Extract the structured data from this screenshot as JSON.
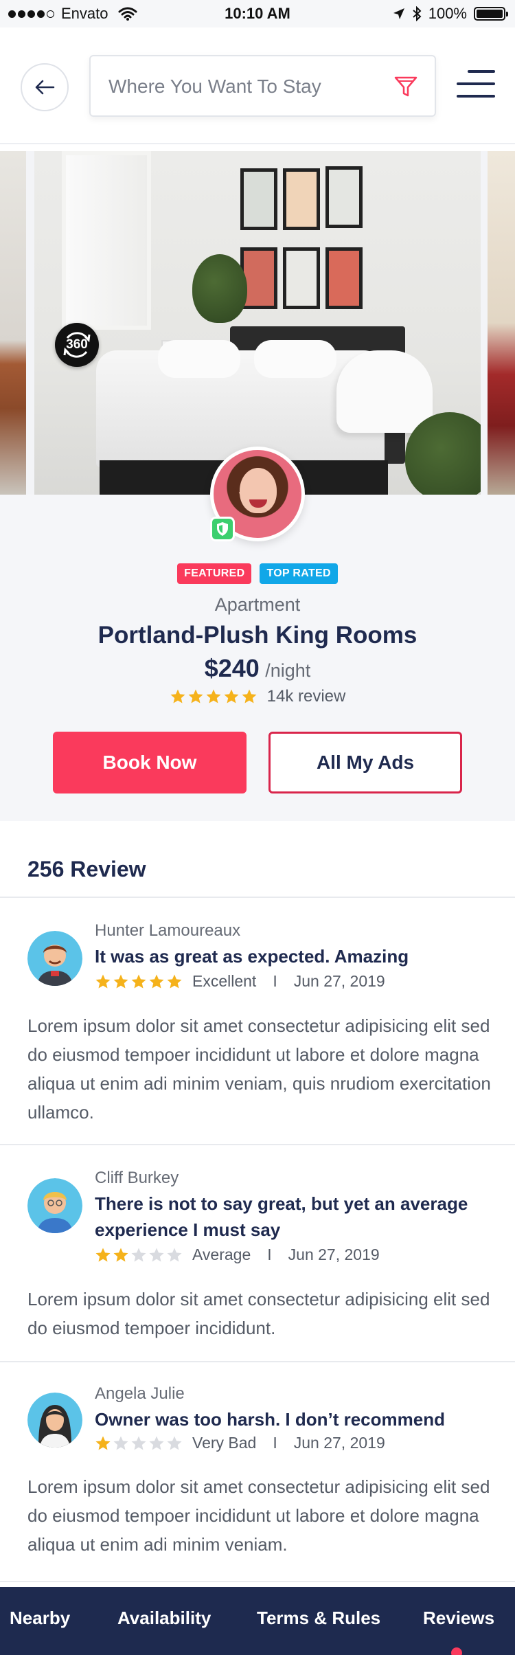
{
  "status_bar": {
    "carrier": "Envato",
    "time": "10:10 AM",
    "battery": "100%"
  },
  "search": {
    "placeholder": "Where You Want To Stay"
  },
  "gallery": {
    "badge_360": "360"
  },
  "listing": {
    "tags": [
      "FEATURED",
      "TOP RATED"
    ],
    "type": "Apartment",
    "title": "Portland-Plush King Rooms",
    "price": "$240",
    "price_unit": "/night",
    "rating": 5,
    "review_count": "14k review",
    "book_label": "Book Now",
    "ads_label": "All My Ads"
  },
  "reviews": {
    "heading": "256 Review",
    "items": [
      {
        "name": "Hunter Lamoureaux",
        "headline": "It was as great as expected. Amazing",
        "rating": 5,
        "rating_label": "Excellent",
        "separator": "I",
        "date": "Jun 27, 2019",
        "body": "Lorem ipsum dolor sit amet consectetur adipisicing elit sed do eiusmod tempoer incididunt ut labore et dolore magna aliqua ut enim adi minim veniam, quis nrudiom exercitation ullamco."
      },
      {
        "name": "Cliff Burkey",
        "headline": "There is not to say great, but yet an average experience I must say",
        "rating": 2,
        "rating_label": "Average",
        "separator": "I",
        "date": "Jun 27, 2019",
        "body": "Lorem ipsum dolor sit amet consectetur adipisicing elit sed do eiusmod tempoer incididunt."
      },
      {
        "name": "Angela Julie",
        "headline": "Owner was too harsh. I don’t recommend",
        "rating": 1,
        "rating_label": "Very Bad",
        "separator": "I",
        "date": "Jun 27, 2019",
        "body": "Lorem ipsum dolor sit amet consectetur adipisicing elit sed do eiusmod tempoer incididunt ut labore et dolore magna aliqua ut enim adi minim veniam."
      }
    ]
  },
  "bottom_nav": {
    "items": [
      "Nearby",
      "Availability",
      "Terms & Rules",
      "Reviews"
    ],
    "active": "Reviews"
  },
  "colors": {
    "primary": "#fa3a5c",
    "navy": "#1f2a4f",
    "star": "#f5b21b",
    "star_empty": "#d9dbe0",
    "featured": "#fa3a5c",
    "top_rated": "#11a7e8",
    "verified": "#3ccf6e"
  }
}
